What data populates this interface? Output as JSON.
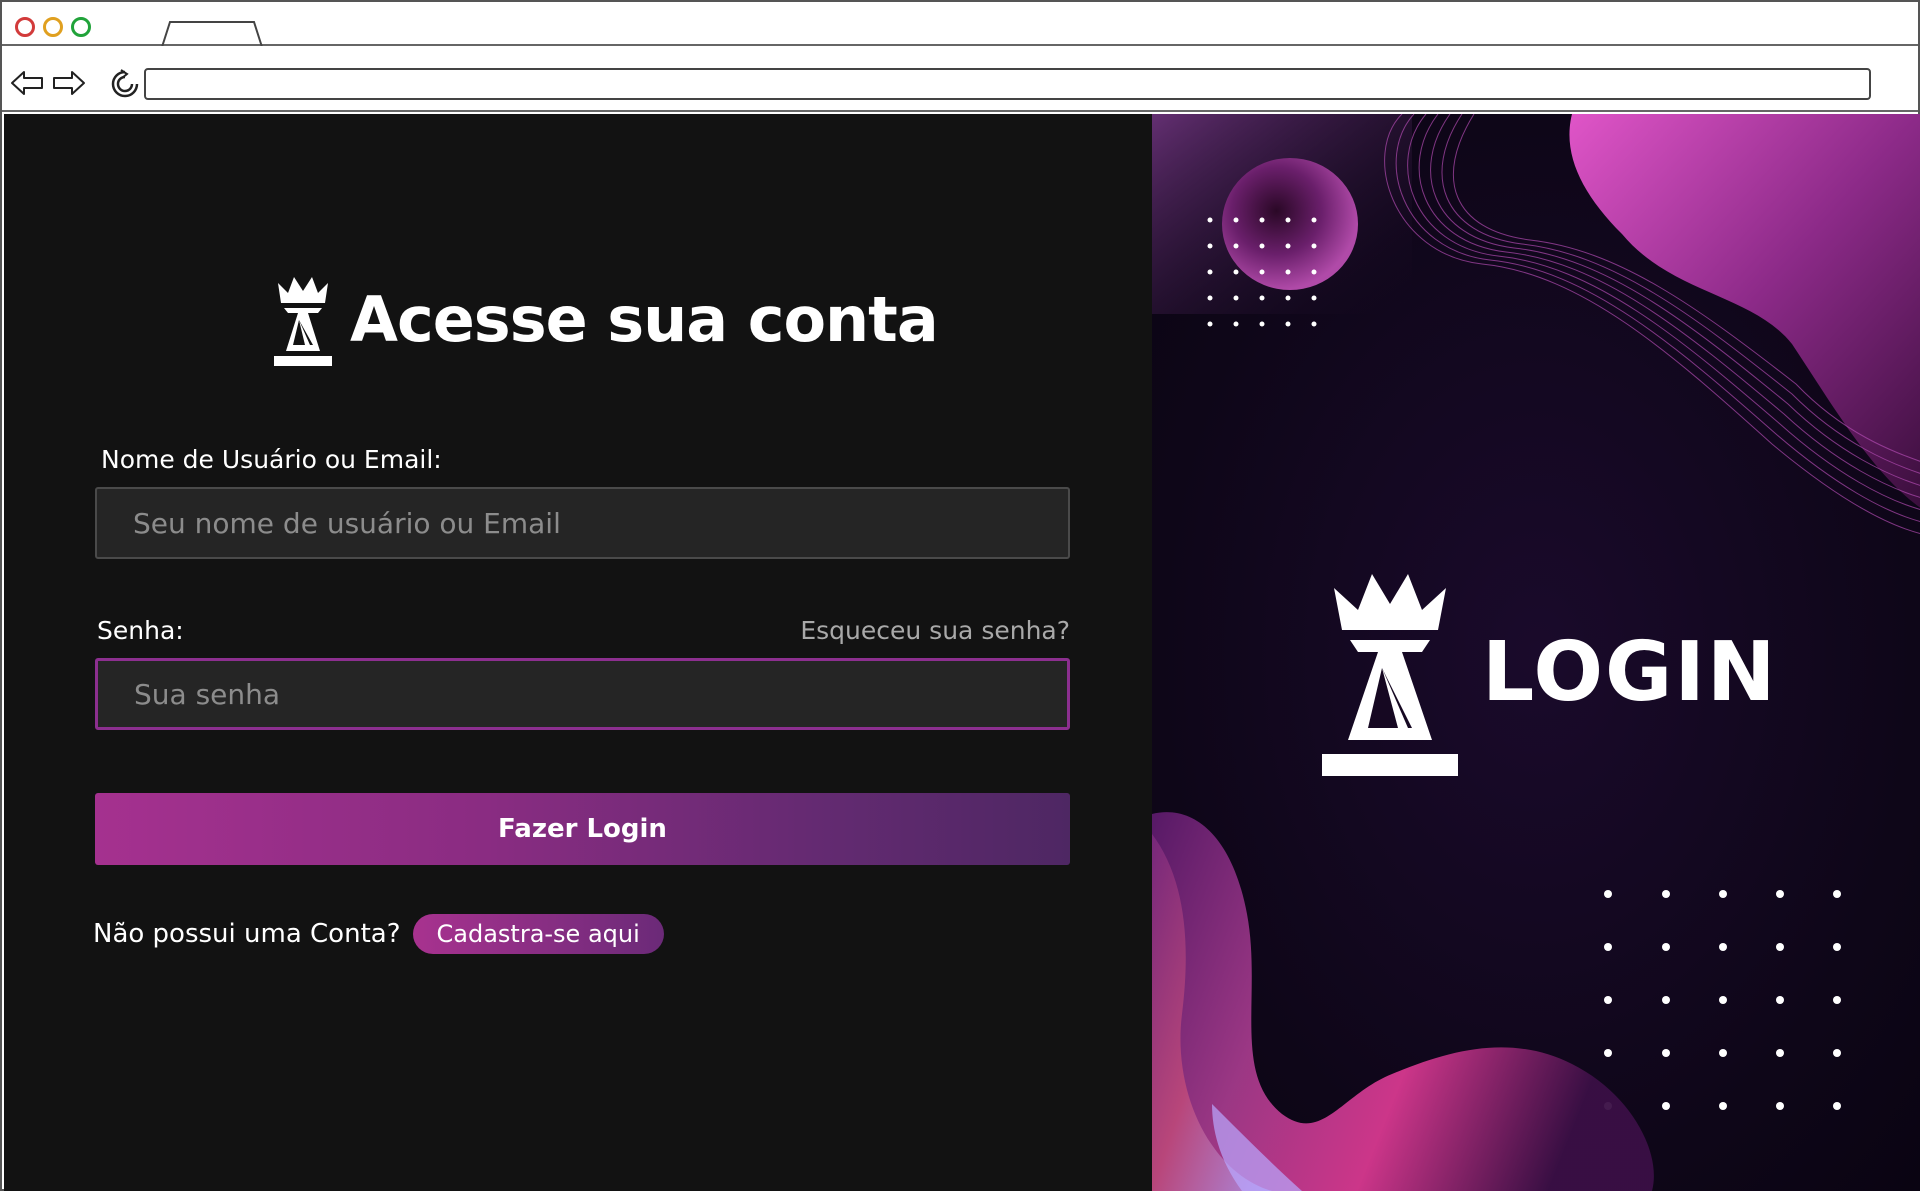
{
  "browser": {
    "tab_label": "",
    "url": ""
  },
  "login": {
    "heading": "Acesse sua conta",
    "username_label": "Nome de Usuário ou Email:",
    "username_placeholder": "Seu nome de usuário ou Email",
    "password_label": "Senha:",
    "password_placeholder": "Sua senha",
    "forgot_password": "Esqueceu sua senha?",
    "submit_label": "Fazer Login",
    "no_account_text": "Não possui uma Conta?",
    "signup_label": "Cadastra-se aqui"
  },
  "hero": {
    "title": "LOGIN"
  },
  "icons": {
    "logo": "chess-queen-icon",
    "back": "arrow-left-icon",
    "forward": "arrow-right-icon",
    "reload": "reload-icon"
  },
  "colors": {
    "background": "#121212",
    "input_bg": "#252525",
    "accent_start": "#a5318f",
    "accent_end": "#4e2763",
    "focus_border": "#8c2f8f",
    "hero_bg": "#0e0618"
  }
}
